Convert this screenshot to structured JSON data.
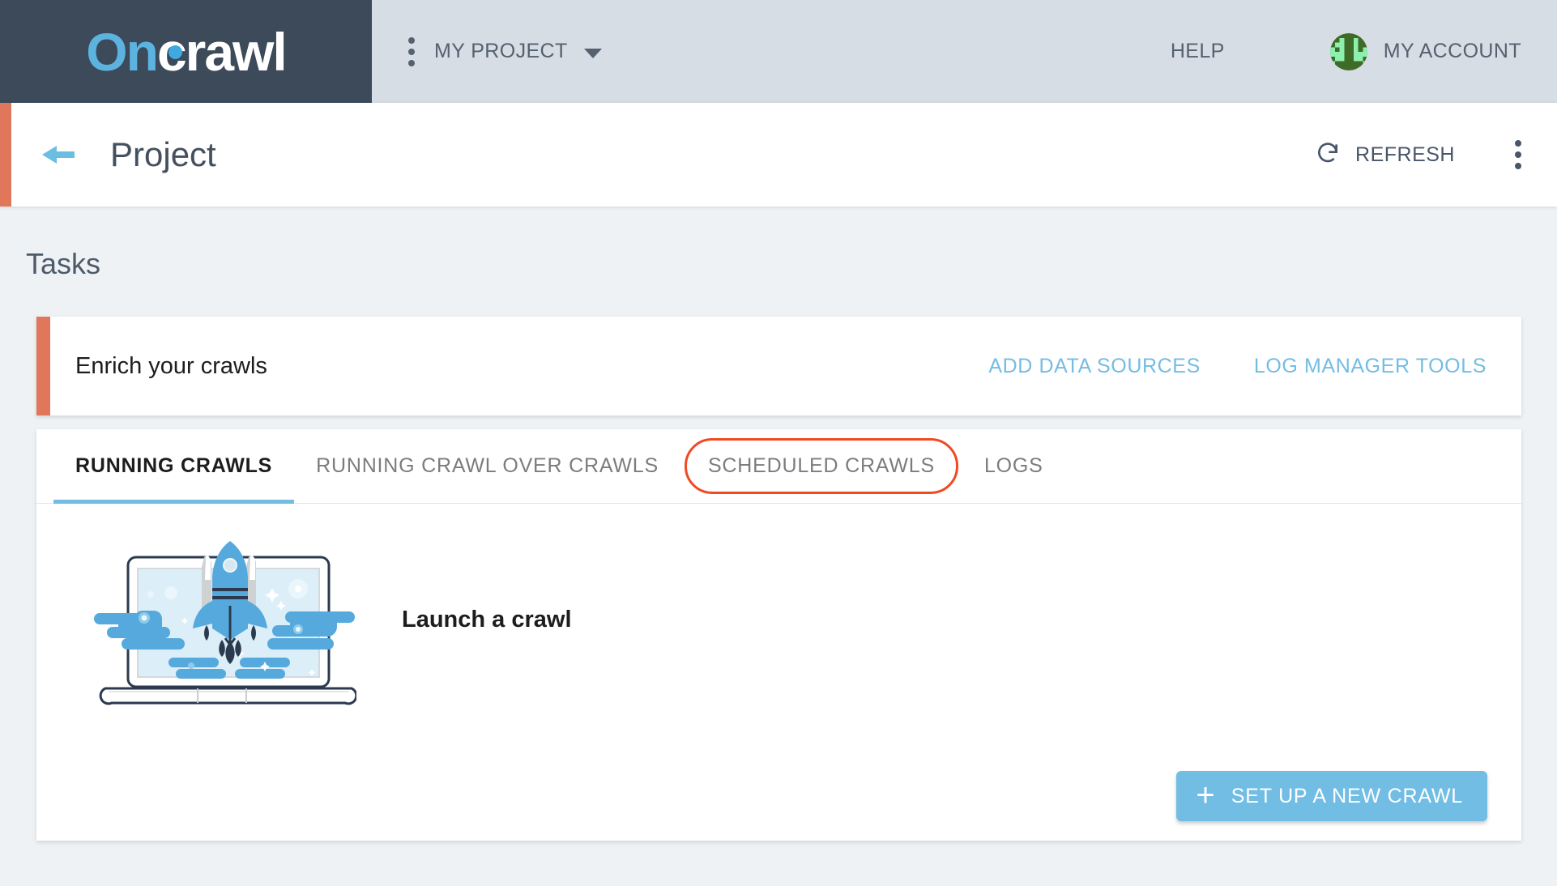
{
  "topnav": {
    "logo": {
      "part1": "On",
      "part2": "crawl"
    },
    "project_menu_icon": "kebab-menu-icon",
    "project_label": "MY PROJECT",
    "help_label": "HELP",
    "account_label": "MY ACCOUNT",
    "avatar_icon": "user-identicon-avatar"
  },
  "page_header": {
    "back_icon": "back-arrow-icon",
    "title": "Project",
    "refresh_label": "REFRESH",
    "refresh_icon": "refresh-icon",
    "more_icon": "kebab-menu-icon"
  },
  "main": {
    "section_title": "Tasks",
    "enrich": {
      "title": "Enrich your crawls",
      "actions": [
        {
          "label": "ADD DATA SOURCES"
        },
        {
          "label": "LOG MANAGER TOOLS"
        }
      ]
    },
    "tabs": [
      {
        "label": "RUNNING CRAWLS",
        "active": true
      },
      {
        "label": "RUNNING CRAWL OVER CRAWLS",
        "active": false
      },
      {
        "label": "SCHEDULED CRAWLS",
        "active": false,
        "highlighted": true
      },
      {
        "label": "LOGS",
        "active": false
      }
    ],
    "panel": {
      "illustration_icon": "rocket-launch-laptop-illustration",
      "empty_state_text": "Launch a crawl",
      "primary_button": {
        "label": "SET UP A NEW CRAWL",
        "icon": "plus-icon"
      }
    }
  },
  "colors": {
    "brand_dark": "#3c4a5a",
    "nav_bg": "#d7dde5",
    "accent_blue": "#72bde4",
    "accent_coral": "#e0765a",
    "highlight_red": "#f04a23",
    "page_bg": "#eef2f4",
    "text_dark": "#44505f"
  }
}
